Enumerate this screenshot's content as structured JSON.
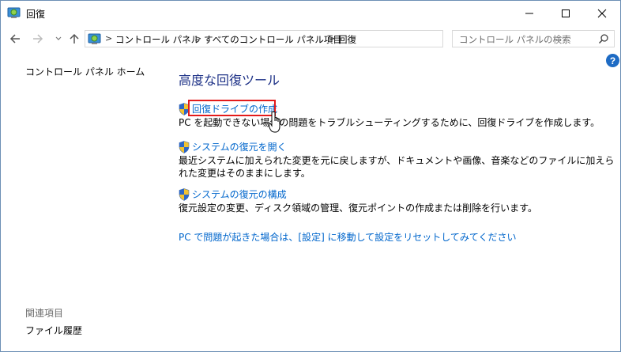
{
  "window": {
    "title": "回復"
  },
  "address": {
    "crumbs": [
      "コントロール パネル",
      "すべてのコントロール パネル項目",
      "回復"
    ],
    "separator": ">"
  },
  "search": {
    "placeholder": "コントロール パネルの検索"
  },
  "help": {
    "label": "?"
  },
  "left_pane": {
    "home": "コントロール パネル ホーム",
    "related_heading": "関連項目",
    "file_history": "ファイル履歴"
  },
  "main": {
    "title": "高度な回復ツール",
    "tasks": [
      {
        "link": "回復ドライブの作成",
        "description": "PC を起動できない場合の問題をトラブルシューティングするために、回復ドライブを作成します。"
      },
      {
        "link": "システムの復元を開く",
        "description": "最近システムに加えられた変更を元に戻しますが、ドキュメントや画像、音楽などのファイルに加えられた変更はそのままにします。"
      },
      {
        "link": "システムの復元の構成",
        "description": "復元設定の変更、ディスク領域の管理、復元ポイントの作成または削除を行います。"
      }
    ],
    "reset_link": "PC で問題が起きた場合は、[設定] に移動して設定をリセットしてみてください"
  },
  "colors": {
    "link": "#0066cc",
    "title": "#1e3287",
    "highlight": "#e31b1b"
  }
}
